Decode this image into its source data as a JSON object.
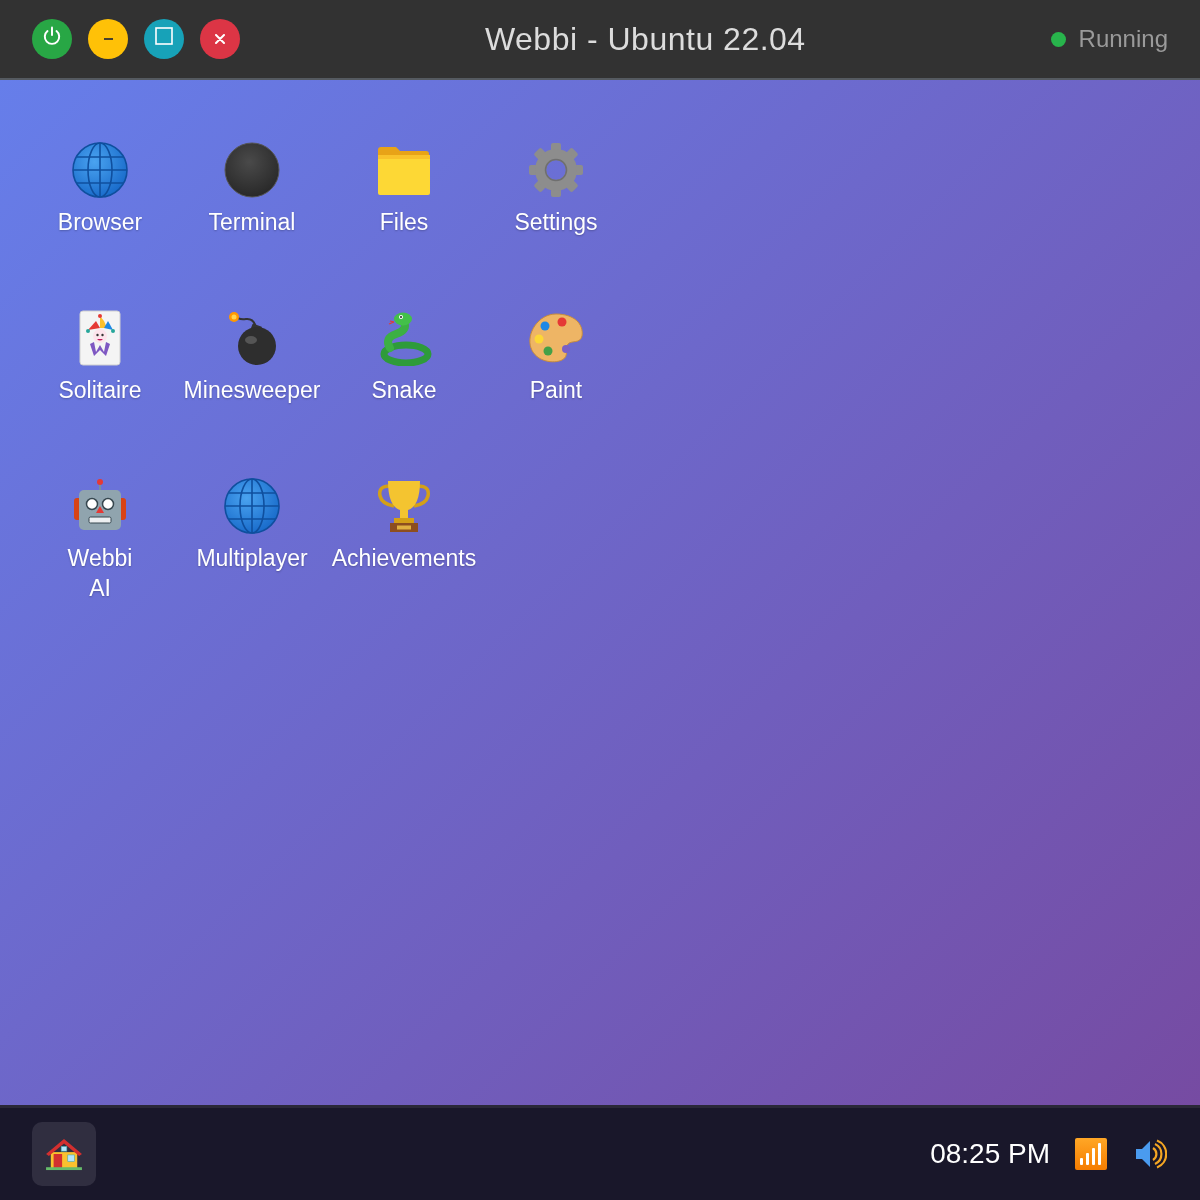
{
  "window": {
    "controls": [
      {
        "kind": "power"
      },
      {
        "kind": "minimize"
      },
      {
        "kind": "maximize"
      },
      {
        "kind": "close"
      }
    ],
    "title": "Webbi - Ubuntu 22.04",
    "status": {
      "label": "Running",
      "color": "#28b44c"
    }
  },
  "desktop": {
    "icons": [
      {
        "label": "Browser",
        "kind": "globe"
      },
      {
        "label": "Terminal",
        "kind": "terminal"
      },
      {
        "label": "Files",
        "kind": "folder"
      },
      {
        "label": "Settings",
        "kind": "gear"
      },
      {
        "label": "Solitaire",
        "kind": "card"
      },
      {
        "label": "Minesweeper",
        "kind": "bomb"
      },
      {
        "label": "Snake",
        "kind": "snake"
      },
      {
        "label": "Paint",
        "kind": "palette"
      },
      {
        "label": "Webbi AI",
        "kind": "robot"
      },
      {
        "label": "Multiplayer",
        "kind": "globe"
      },
      {
        "label": "Achievements",
        "kind": "trophy"
      }
    ]
  },
  "taskbar": {
    "launcher": {
      "kind": "home"
    },
    "clock": "08:25 PM",
    "tray": [
      {
        "kind": "signal"
      },
      {
        "kind": "volume"
      }
    ]
  }
}
